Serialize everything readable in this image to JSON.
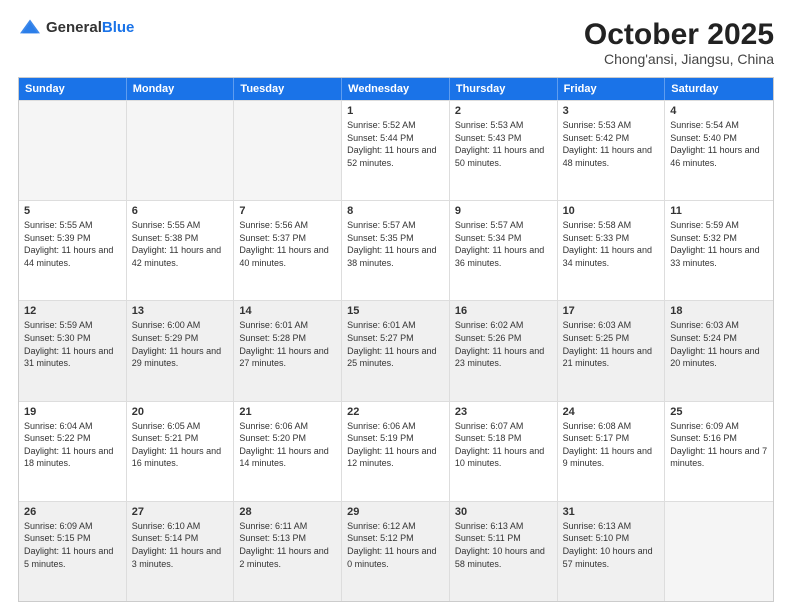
{
  "header": {
    "logo_general": "General",
    "logo_blue": "Blue",
    "month_title": "October 2025",
    "location": "Chong'ansi, Jiangsu, China"
  },
  "weekdays": [
    "Sunday",
    "Monday",
    "Tuesday",
    "Wednesday",
    "Thursday",
    "Friday",
    "Saturday"
  ],
  "rows": [
    [
      {
        "day": "",
        "empty": true
      },
      {
        "day": "",
        "empty": true
      },
      {
        "day": "",
        "empty": true
      },
      {
        "day": "1",
        "sunrise": "Sunrise: 5:52 AM",
        "sunset": "Sunset: 5:44 PM",
        "daylight": "Daylight: 11 hours and 52 minutes."
      },
      {
        "day": "2",
        "sunrise": "Sunrise: 5:53 AM",
        "sunset": "Sunset: 5:43 PM",
        "daylight": "Daylight: 11 hours and 50 minutes."
      },
      {
        "day": "3",
        "sunrise": "Sunrise: 5:53 AM",
        "sunset": "Sunset: 5:42 PM",
        "daylight": "Daylight: 11 hours and 48 minutes."
      },
      {
        "day": "4",
        "sunrise": "Sunrise: 5:54 AM",
        "sunset": "Sunset: 5:40 PM",
        "daylight": "Daylight: 11 hours and 46 minutes."
      }
    ],
    [
      {
        "day": "5",
        "sunrise": "Sunrise: 5:55 AM",
        "sunset": "Sunset: 5:39 PM",
        "daylight": "Daylight: 11 hours and 44 minutes."
      },
      {
        "day": "6",
        "sunrise": "Sunrise: 5:55 AM",
        "sunset": "Sunset: 5:38 PM",
        "daylight": "Daylight: 11 hours and 42 minutes."
      },
      {
        "day": "7",
        "sunrise": "Sunrise: 5:56 AM",
        "sunset": "Sunset: 5:37 PM",
        "daylight": "Daylight: 11 hours and 40 minutes."
      },
      {
        "day": "8",
        "sunrise": "Sunrise: 5:57 AM",
        "sunset": "Sunset: 5:35 PM",
        "daylight": "Daylight: 11 hours and 38 minutes."
      },
      {
        "day": "9",
        "sunrise": "Sunrise: 5:57 AM",
        "sunset": "Sunset: 5:34 PM",
        "daylight": "Daylight: 11 hours and 36 minutes."
      },
      {
        "day": "10",
        "sunrise": "Sunrise: 5:58 AM",
        "sunset": "Sunset: 5:33 PM",
        "daylight": "Daylight: 11 hours and 34 minutes."
      },
      {
        "day": "11",
        "sunrise": "Sunrise: 5:59 AM",
        "sunset": "Sunset: 5:32 PM",
        "daylight": "Daylight: 11 hours and 33 minutes."
      }
    ],
    [
      {
        "day": "12",
        "sunrise": "Sunrise: 5:59 AM",
        "sunset": "Sunset: 5:30 PM",
        "daylight": "Daylight: 11 hours and 31 minutes.",
        "shaded": true
      },
      {
        "day": "13",
        "sunrise": "Sunrise: 6:00 AM",
        "sunset": "Sunset: 5:29 PM",
        "daylight": "Daylight: 11 hours and 29 minutes.",
        "shaded": true
      },
      {
        "day": "14",
        "sunrise": "Sunrise: 6:01 AM",
        "sunset": "Sunset: 5:28 PM",
        "daylight": "Daylight: 11 hours and 27 minutes.",
        "shaded": true
      },
      {
        "day": "15",
        "sunrise": "Sunrise: 6:01 AM",
        "sunset": "Sunset: 5:27 PM",
        "daylight": "Daylight: 11 hours and 25 minutes.",
        "shaded": true
      },
      {
        "day": "16",
        "sunrise": "Sunrise: 6:02 AM",
        "sunset": "Sunset: 5:26 PM",
        "daylight": "Daylight: 11 hours and 23 minutes.",
        "shaded": true
      },
      {
        "day": "17",
        "sunrise": "Sunrise: 6:03 AM",
        "sunset": "Sunset: 5:25 PM",
        "daylight": "Daylight: 11 hours and 21 minutes.",
        "shaded": true
      },
      {
        "day": "18",
        "sunrise": "Sunrise: 6:03 AM",
        "sunset": "Sunset: 5:24 PM",
        "daylight": "Daylight: 11 hours and 20 minutes.",
        "shaded": true
      }
    ],
    [
      {
        "day": "19",
        "sunrise": "Sunrise: 6:04 AM",
        "sunset": "Sunset: 5:22 PM",
        "daylight": "Daylight: 11 hours and 18 minutes."
      },
      {
        "day": "20",
        "sunrise": "Sunrise: 6:05 AM",
        "sunset": "Sunset: 5:21 PM",
        "daylight": "Daylight: 11 hours and 16 minutes."
      },
      {
        "day": "21",
        "sunrise": "Sunrise: 6:06 AM",
        "sunset": "Sunset: 5:20 PM",
        "daylight": "Daylight: 11 hours and 14 minutes."
      },
      {
        "day": "22",
        "sunrise": "Sunrise: 6:06 AM",
        "sunset": "Sunset: 5:19 PM",
        "daylight": "Daylight: 11 hours and 12 minutes."
      },
      {
        "day": "23",
        "sunrise": "Sunrise: 6:07 AM",
        "sunset": "Sunset: 5:18 PM",
        "daylight": "Daylight: 11 hours and 10 minutes."
      },
      {
        "day": "24",
        "sunrise": "Sunrise: 6:08 AM",
        "sunset": "Sunset: 5:17 PM",
        "daylight": "Daylight: 11 hours and 9 minutes."
      },
      {
        "day": "25",
        "sunrise": "Sunrise: 6:09 AM",
        "sunset": "Sunset: 5:16 PM",
        "daylight": "Daylight: 11 hours and 7 minutes."
      }
    ],
    [
      {
        "day": "26",
        "sunrise": "Sunrise: 6:09 AM",
        "sunset": "Sunset: 5:15 PM",
        "daylight": "Daylight: 11 hours and 5 minutes.",
        "shaded": true
      },
      {
        "day": "27",
        "sunrise": "Sunrise: 6:10 AM",
        "sunset": "Sunset: 5:14 PM",
        "daylight": "Daylight: 11 hours and 3 minutes.",
        "shaded": true
      },
      {
        "day": "28",
        "sunrise": "Sunrise: 6:11 AM",
        "sunset": "Sunset: 5:13 PM",
        "daylight": "Daylight: 11 hours and 2 minutes.",
        "shaded": true
      },
      {
        "day": "29",
        "sunrise": "Sunrise: 6:12 AM",
        "sunset": "Sunset: 5:12 PM",
        "daylight": "Daylight: 11 hours and 0 minutes.",
        "shaded": true
      },
      {
        "day": "30",
        "sunrise": "Sunrise: 6:13 AM",
        "sunset": "Sunset: 5:11 PM",
        "daylight": "Daylight: 10 hours and 58 minutes.",
        "shaded": true
      },
      {
        "day": "31",
        "sunrise": "Sunrise: 6:13 AM",
        "sunset": "Sunset: 5:10 PM",
        "daylight": "Daylight: 10 hours and 57 minutes.",
        "shaded": true
      },
      {
        "day": "",
        "empty": true,
        "shaded": true
      }
    ]
  ]
}
